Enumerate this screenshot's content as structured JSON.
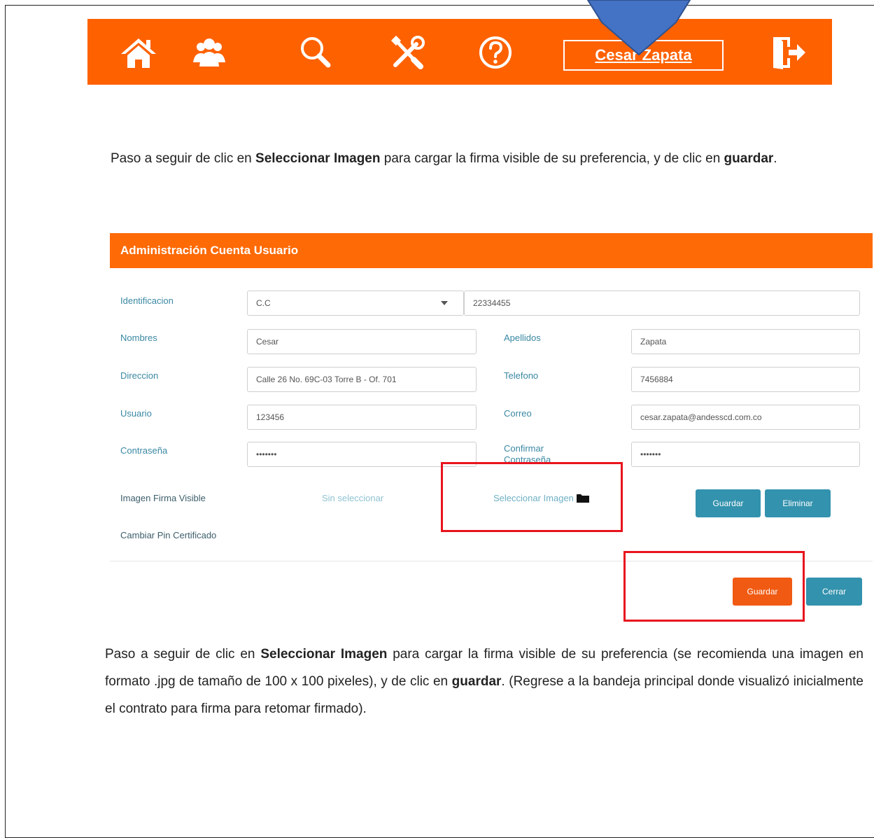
{
  "nav": {
    "icons": [
      "home-icon",
      "users-icon",
      "search-icon",
      "tools-icon",
      "help-icon",
      "logout-icon"
    ],
    "user_name": "Cesar Zapata"
  },
  "step1": {
    "pre": "Paso a seguir de clic en ",
    "bold1": "Seleccionar Imagen",
    "mid": " para cargar la firma visible de su preferencia, y de clic en ",
    "bold2": "guardar",
    "end": "."
  },
  "form": {
    "title": "Administración Cuenta Usuario",
    "labels": {
      "identificacion": "Identificacion",
      "nombres": "Nombres",
      "apellidos": "Apellidos",
      "direccion": "Direccion",
      "telefono": "Telefono",
      "usuario": "Usuario",
      "correo": "Correo",
      "contrasena": "Contraseña",
      "confirmar": "Confirmar Contraseña",
      "imagen_firma": "Imagen Firma Visible",
      "cambiar_pin": "Cambiar Pin Certificado"
    },
    "values": {
      "tipo_id": "C.C",
      "numero_id": "22334455",
      "nombres": "Cesar",
      "apellidos": "Zapata",
      "direccion": "Calle 26 No. 69C-03 Torre B - Of. 701",
      "telefono": "7456884",
      "usuario": "123456",
      "correo": "cesar.zapata@andesscd.com.co",
      "contrasena": "•••••••",
      "confirmar": "•••••••"
    },
    "sin_seleccionar": "Sin seleccionar",
    "seleccionar_imagen": "Seleccionar Imagen",
    "buttons": {
      "guardar_firma": "Guardar",
      "eliminar": "Eliminar",
      "guardar": "Guardar",
      "cerrar": "Cerrar"
    }
  },
  "step2": {
    "pre": "Paso a seguir de clic en ",
    "bold1": "Seleccionar Imagen",
    "mid": " para cargar la firma visible de su preferencia (se recomienda una imagen en formato .jpg de tamaño de 100 x 100 pixeles), y de clic en ",
    "bold2": "guardar",
    "end": ". (Regrese a la bandeja principal donde visualizó inicialmente el contrato para firma para retomar firmado)."
  },
  "colors": {
    "nav_orange": "#fe6100",
    "teal": "#3392ad",
    "highlight_red": "#e8141e",
    "callout_blue": "#4472c4"
  }
}
